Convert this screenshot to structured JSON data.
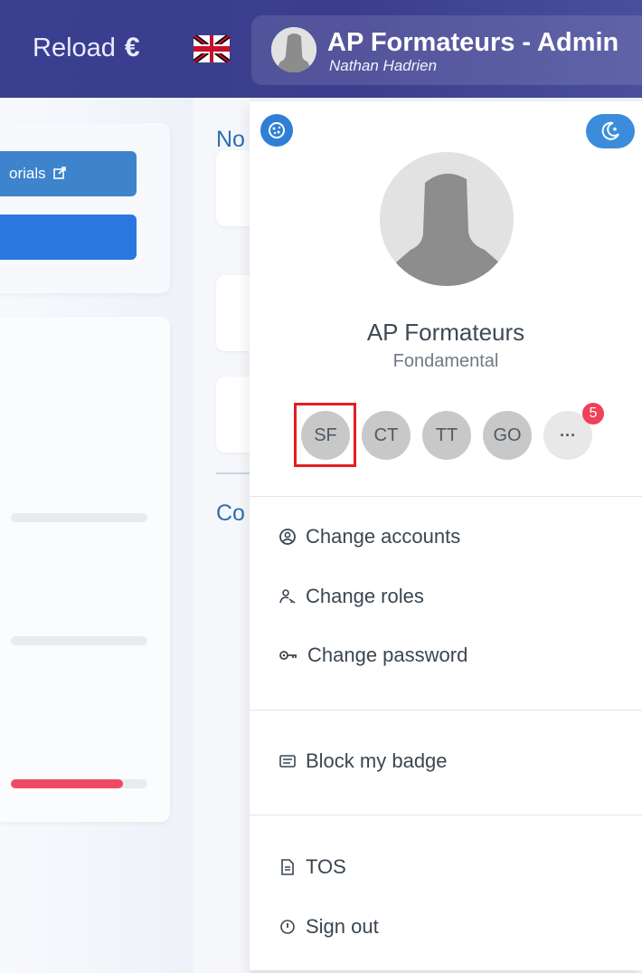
{
  "header": {
    "reload_label": "Reload",
    "currency_symbol": "€",
    "language_flag": "uk-flag-icon",
    "account_title": "AP Formateurs - Admin",
    "account_user": "Nathan Hadrien"
  },
  "background": {
    "tutorials_label": "orials",
    "mid_label_top": "No",
    "mid_label_bottom": "Co",
    "progress_fill": 0.82
  },
  "profile": {
    "org_name": "AP Formateurs",
    "org_level": "Fondamental",
    "accounts": [
      "SF",
      "CT",
      "TT",
      "GO"
    ],
    "more_label": "···",
    "more_count": "5",
    "selected_account": "SF"
  },
  "menu": {
    "change_accounts": "Change accounts",
    "change_roles": "Change roles",
    "change_password": "Change password",
    "block_badge": "Block my badge",
    "tos": "TOS",
    "sign_out": "Sign out"
  },
  "colors": {
    "header_bg": "#3c3d8e",
    "accent_blue": "#2f7fd6",
    "badge_red": "#f0405a",
    "highlight_red": "#e02020"
  }
}
